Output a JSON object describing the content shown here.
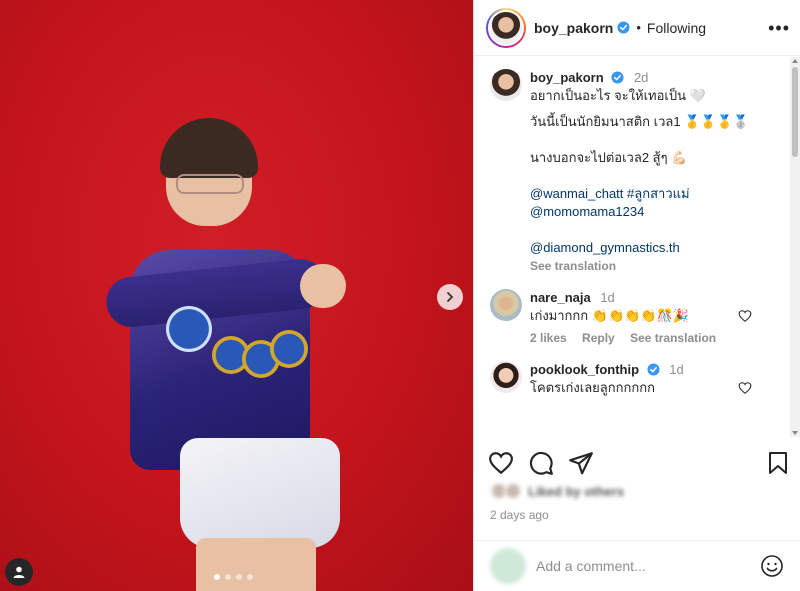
{
  "header": {
    "username": "boy_pakorn",
    "follow_status": "Following",
    "more_icon": "more-horizontal-icon"
  },
  "carousel": {
    "slide_count": 4,
    "active_index": 0
  },
  "caption": {
    "username": "boy_pakorn",
    "time": "2d",
    "line1": "อยากเป็นอะไร จะให้เทอเป็น 🤍",
    "line2": "วันนี้เป็นนักยิมนาสติก เวล1 🥇🥇🥇🥈",
    "line3": "นางบอกจะไปต่อเวล2 สู้ๆ 💪🏻",
    "mention1": "@wanmai_chatt",
    "hashtag": "#ลูกสาวแม่",
    "mention2": "@momomama1234",
    "mention3": "@diamond_gymnastics.th",
    "see_translation": "See translation"
  },
  "comments": [
    {
      "username": "nare_naja",
      "time": "1d",
      "text": "เก่งมากกก 👏👏👏👏🎊🎉",
      "likes": "2 likes",
      "reply": "Reply",
      "see_translation": "See translation"
    },
    {
      "username": "pooklook_fonthip",
      "time": "1d",
      "text": "โคตรเก่งเลยลูกกกกกก"
    }
  ],
  "post_meta": {
    "likes": "Liked by others",
    "date": "2 days ago"
  },
  "add_comment": {
    "placeholder": "Add a comment..."
  },
  "colors": {
    "verified_blue": "#3897f0",
    "link": "#00376b",
    "muted": "#8e8e8e",
    "wall_red": "#c8161e"
  }
}
